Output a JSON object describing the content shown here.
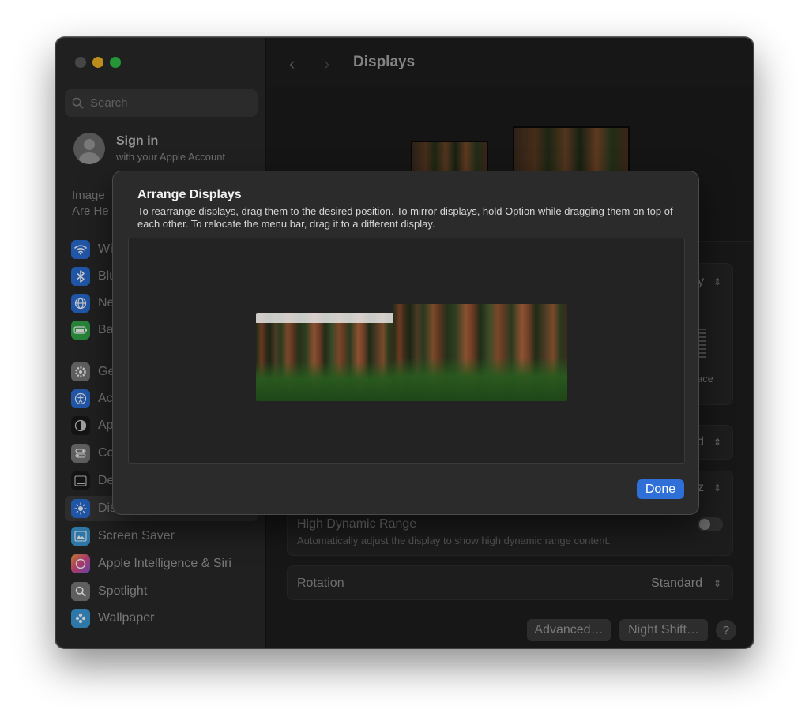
{
  "window": {
    "traffic_lights": {
      "close_color": "#5a5a5a",
      "minimize_color": "#f4b625",
      "maximize_color": "#2fc148"
    }
  },
  "sidebar": {
    "search_placeholder": "Search",
    "account": {
      "title": "Sign in",
      "subtitle": "with your Apple Account"
    },
    "promo_lines": [
      "Image",
      "Are He"
    ],
    "items": [
      {
        "label": "Wi",
        "icon": "wifi-icon",
        "color": "#2b6fd6"
      },
      {
        "label": "Blu",
        "icon": "bluetooth-icon",
        "color": "#2b6fd6"
      },
      {
        "label": "Ne",
        "icon": "globe-icon",
        "color": "#2b6fd6"
      },
      {
        "label": "Ba",
        "icon": "battery-icon",
        "color": "#34a84a"
      },
      {
        "label": "Ge",
        "icon": "gear-icon",
        "color": "#7a7a7a"
      },
      {
        "label": "Ac",
        "icon": "accessibility-icon",
        "color": "#2b6fd6"
      },
      {
        "label": "Ap",
        "icon": "appearance-icon",
        "color": "#1a1a1a"
      },
      {
        "label": "Co",
        "icon": "control-center-icon",
        "color": "#7a7a7a"
      },
      {
        "label": "De",
        "icon": "desktop-dock-icon",
        "color": "#1a1a1a"
      },
      {
        "label": "Dis",
        "icon": "sun-icon",
        "color": "#2b6fd6"
      },
      {
        "label": "Screen Saver",
        "icon": "screen-saver-icon",
        "color": "#3a9ad9"
      },
      {
        "label": "Apple Intelligence & Siri",
        "icon": "siri-icon",
        "color": "#d9488a"
      },
      {
        "label": "Spotlight",
        "icon": "spotlight-icon",
        "color": "#7a7a7a"
      },
      {
        "label": "Wallpaper",
        "icon": "wallpaper-icon",
        "color": "#3a9ad9"
      }
    ]
  },
  "toolbar": {
    "title": "Displays",
    "back": "‹",
    "forward": "›"
  },
  "settings": {
    "partial_value_1": "y",
    "partial_label_space": "ace",
    "partial_value_2": "d",
    "partial_value_3": "z",
    "hdr": {
      "label": "High Dynamic Range",
      "description": "Automatically adjust the display to show high dynamic range content."
    },
    "rotation": {
      "label": "Rotation",
      "value": "Standard"
    }
  },
  "buttons": {
    "advanced": "Advanced…",
    "night_shift": "Night Shift…",
    "help": "?"
  },
  "sheet": {
    "title": "Arrange Displays",
    "description": "To rearrange displays, drag them to the desired position. To mirror displays, hold Option while dragging them on top of each other. To relocate the menu bar, drag it to a different display.",
    "done_label": "Done",
    "accent": "#2f6fd8"
  }
}
